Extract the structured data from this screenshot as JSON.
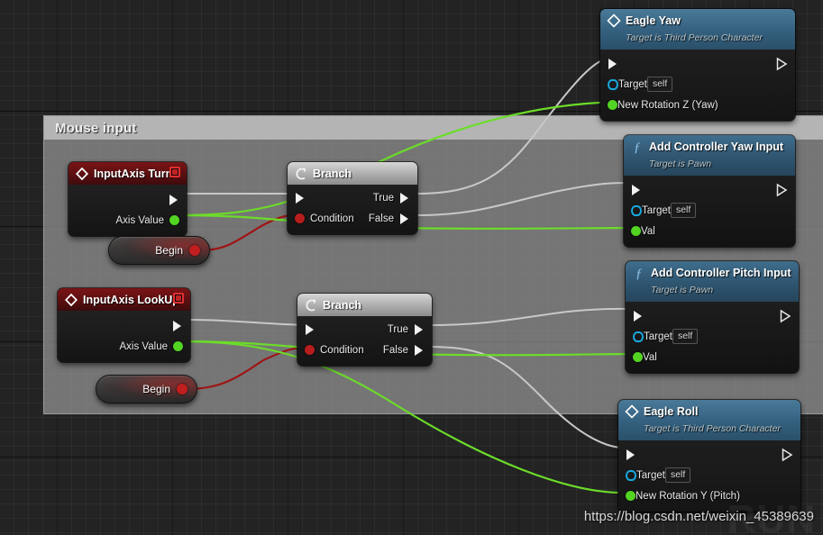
{
  "editor": {
    "name": "Unreal Engine Blueprint Event Graph",
    "background_color": "#232323",
    "grid_color": "#2d2d2d"
  },
  "comment_box": {
    "title": "Mouse input",
    "header_color": "#bababa",
    "body_color": "#969696"
  },
  "nodes": [
    {
      "id": "eagle-yaw",
      "kind": "event-call",
      "title": "Eagle Yaw",
      "subtitle": "Target is Third Person Character",
      "header_color": "#2f5570",
      "icon": "diamond-icon",
      "pins": [
        {
          "name": "exec-in",
          "label": "",
          "type": "exec"
        },
        {
          "name": "exec-out",
          "label": "",
          "type": "exec-out"
        },
        {
          "name": "target",
          "label": "Target",
          "type": "object",
          "value": "self"
        },
        {
          "name": "new-rotation-z",
          "label": "New Rotation Z (Yaw)",
          "type": "float"
        }
      ]
    },
    {
      "id": "add-controller-yaw-input",
      "kind": "function",
      "title": "Add Controller Yaw Input",
      "subtitle": "Target is Pawn",
      "header_color": "#2f5570",
      "icon": "function-icon",
      "pins": [
        {
          "name": "exec-in",
          "label": "",
          "type": "exec"
        },
        {
          "name": "exec-out",
          "label": "",
          "type": "exec-out"
        },
        {
          "name": "target",
          "label": "Target",
          "type": "object",
          "value": "self"
        },
        {
          "name": "val",
          "label": "Val",
          "type": "float"
        }
      ]
    },
    {
      "id": "add-controller-pitch-input",
      "kind": "function",
      "title": "Add Controller Pitch Input",
      "subtitle": "Target is Pawn",
      "header_color": "#2f5570",
      "icon": "function-icon",
      "pins": [
        {
          "name": "exec-in",
          "label": "",
          "type": "exec"
        },
        {
          "name": "exec-out",
          "label": "",
          "type": "exec-out"
        },
        {
          "name": "target",
          "label": "Target",
          "type": "object",
          "value": "self"
        },
        {
          "name": "val",
          "label": "Val",
          "type": "float"
        }
      ]
    },
    {
      "id": "eagle-roll",
      "kind": "event-call",
      "title": "Eagle Roll",
      "subtitle": "Target is Third Person Character",
      "header_color": "#2f5570",
      "icon": "diamond-icon",
      "pins": [
        {
          "name": "exec-in",
          "label": "",
          "type": "exec"
        },
        {
          "name": "exec-out",
          "label": "",
          "type": "exec-out"
        },
        {
          "name": "target",
          "label": "Target",
          "type": "object",
          "value": "self"
        },
        {
          "name": "new-rotation-y",
          "label": "New Rotation Y (Pitch)",
          "type": "float"
        }
      ]
    },
    {
      "id": "inputaxis-turn",
      "kind": "event",
      "title": "InputAxis Turn",
      "subtitle": "",
      "header_color": "#5b0f11",
      "icon": "diamond-icon",
      "breakpoint": true,
      "pins": [
        {
          "name": "exec-out",
          "label": "",
          "type": "exec-out"
        },
        {
          "name": "axis-value",
          "label": "Axis Value",
          "type": "float"
        }
      ]
    },
    {
      "id": "inputaxis-lookup",
      "kind": "event",
      "title": "InputAxis LookUp",
      "subtitle": "",
      "header_color": "#5b0f11",
      "icon": "diamond-icon",
      "breakpoint": true,
      "pins": [
        {
          "name": "exec-out",
          "label": "",
          "type": "exec-out"
        },
        {
          "name": "axis-value",
          "label": "Axis Value",
          "type": "float"
        }
      ]
    },
    {
      "id": "branch-top",
      "kind": "flow",
      "title": "Branch",
      "subtitle": "",
      "header_color": "#a8a8a8",
      "icon": "branch-icon",
      "pins": [
        {
          "name": "exec-in",
          "label": "",
          "type": "exec"
        },
        {
          "name": "condition",
          "label": "Condition",
          "type": "bool"
        },
        {
          "name": "true",
          "label": "True",
          "type": "exec-out"
        },
        {
          "name": "false",
          "label": "False",
          "type": "exec-out"
        }
      ]
    },
    {
      "id": "branch-bottom",
      "kind": "flow",
      "title": "Branch",
      "subtitle": "",
      "header_color": "#a8a8a8",
      "icon": "branch-icon",
      "pins": [
        {
          "name": "exec-in",
          "label": "",
          "type": "exec"
        },
        {
          "name": "condition",
          "label": "Condition",
          "type": "bool"
        },
        {
          "name": "true",
          "label": "True",
          "type": "exec-out"
        },
        {
          "name": "false",
          "label": "False",
          "type": "exec-out"
        }
      ]
    }
  ],
  "pill_nodes": [
    {
      "id": "begin-top",
      "label": "Begin",
      "pin_color": "#c11f1f"
    },
    {
      "id": "begin-bottom",
      "label": "Begin",
      "pin_color": "#c11f1f"
    }
  ],
  "labels": {
    "eagle_yaw_title": "Eagle Yaw",
    "eagle_yaw_subtitle": "Target is Third Person Character",
    "eagle_yaw_target": "Target",
    "eagle_yaw_target_value": "self",
    "eagle_yaw_rotation": "New Rotation Z (Yaw)",
    "yaw_input_title": "Add Controller Yaw Input",
    "yaw_input_subtitle": "Target is Pawn",
    "yaw_input_target": "Target",
    "yaw_input_target_value": "self",
    "yaw_input_val": "Val",
    "pitch_input_title": "Add Controller Pitch Input",
    "pitch_input_subtitle": "Target is Pawn",
    "pitch_input_target": "Target",
    "pitch_input_target_value": "self",
    "pitch_input_val": "Val",
    "eagle_roll_title": "Eagle Roll",
    "eagle_roll_subtitle": "Target is Third Person Character",
    "eagle_roll_target": "Target",
    "eagle_roll_target_value": "self",
    "eagle_roll_rotation": "New Rotation Y (Pitch)",
    "turn_title": "InputAxis Turn",
    "turn_axis_value": "Axis Value",
    "lookup_title": "InputAxis LookUp",
    "lookup_axis_value": "Axis Value",
    "branch_top_title": "Branch",
    "branch_top_condition": "Condition",
    "branch_top_true": "True",
    "branch_top_false": "False",
    "branch_bottom_title": "Branch",
    "branch_bottom_condition": "Condition",
    "branch_bottom_true": "True",
    "branch_bottom_false": "False",
    "begin_top": "Begin",
    "begin_bottom": "Begin"
  },
  "wires": {
    "exec_color": "#c8c8c8",
    "float_color": "#6cdc2a",
    "bool_color": "#9e1515"
  },
  "watermark": {
    "url": "https://blog.csdn.net/weixin_45389639",
    "ghost": "RUN"
  }
}
